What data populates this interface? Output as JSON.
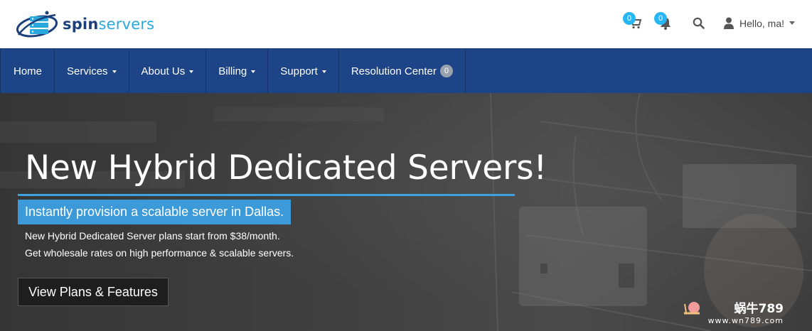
{
  "brand": {
    "name_part1": "spin",
    "name_part2": "servers",
    "primary": "#1b3f7a",
    "accent": "#29a8e0"
  },
  "header": {
    "cart_icon": "cart-icon",
    "cart_count": "0",
    "notif_icon": "bell-icon",
    "notif_count": "0",
    "search_icon": "search-icon",
    "user_icon": "user-icon",
    "user_label": "Hello, ma!"
  },
  "nav": {
    "items": [
      {
        "label": "Home"
      },
      {
        "label": "Services"
      },
      {
        "label": "About Us"
      },
      {
        "label": "Billing"
      },
      {
        "label": "Support"
      },
      {
        "label": "Resolution Center",
        "badge": "0"
      }
    ],
    "bg": "#1c4486"
  },
  "hero": {
    "title": "New Hybrid Dedicated Servers!",
    "tagline": "Instantly provision a scalable server in Dallas.",
    "line1": "New Hybrid Dedicated Server plans start from $38/month.",
    "line2": "Get wholesale rates on high performance & scalable servers.",
    "button": "View Plans & Features",
    "accent": "#3d9ad8"
  },
  "watermark": {
    "top": "蜗牛789",
    "bottom": "www.wn789.com"
  }
}
